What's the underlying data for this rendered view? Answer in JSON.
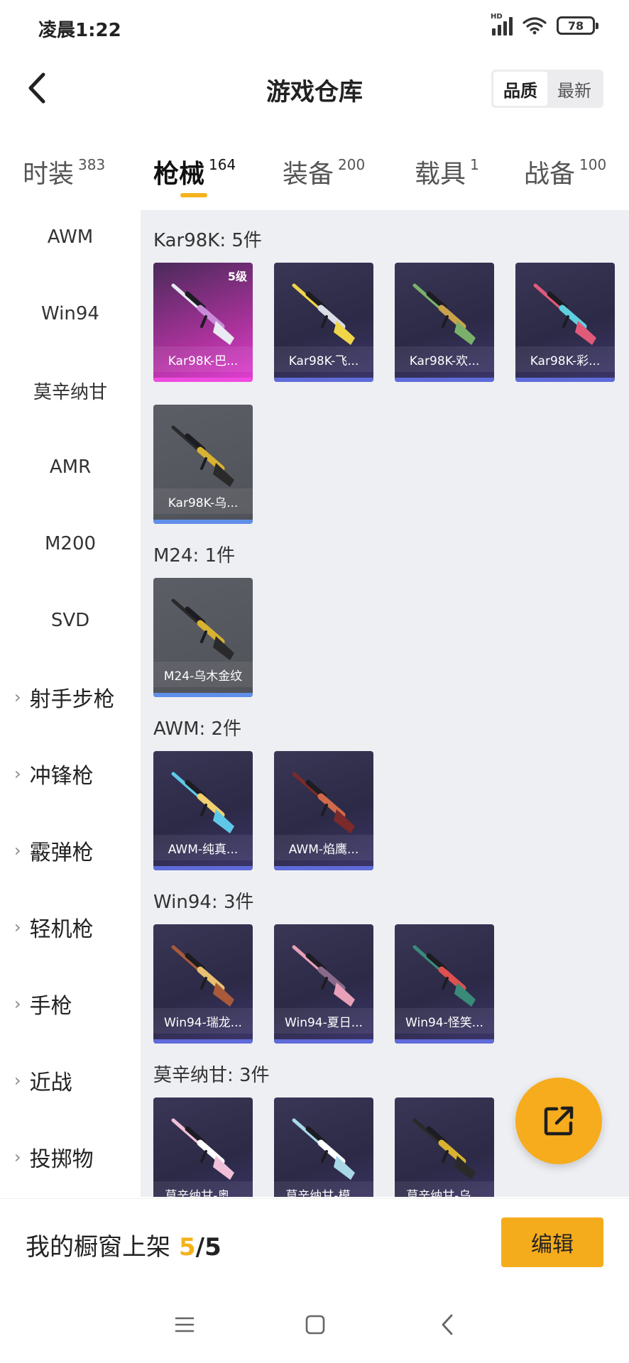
{
  "status_bar": {
    "time": "凌晨1:22",
    "battery": "78",
    "network_label": "HD"
  },
  "header": {
    "title": "游戏仓库",
    "sort_options": [
      "品质",
      "最新"
    ],
    "active_sort": "品质"
  },
  "category_tabs": [
    {
      "label": "时装",
      "count": "383"
    },
    {
      "label": "枪械",
      "count": "164",
      "active": true
    },
    {
      "label": "装备",
      "count": "200"
    },
    {
      "label": "载具",
      "count": "1"
    },
    {
      "label": "战备",
      "count": "100"
    }
  ],
  "sidebar": {
    "items": [
      "AWM",
      "Win94",
      "莫辛纳甘",
      "AMR",
      "M200",
      "SVD"
    ],
    "groups": [
      "射手步枪",
      "冲锋枪",
      "霰弹枪",
      "轻机枪",
      "手枪",
      "近战",
      "投掷物"
    ]
  },
  "sections": [
    {
      "title": "Kar98K: 5件",
      "items": [
        {
          "name": "Kar98K-巴...",
          "level": "5级",
          "quality": "pink",
          "gun_color": "#e9eaf2",
          "accent": "#c98bd8"
        },
        {
          "name": "Kar98K-飞...",
          "quality": "purple",
          "gun_color": "#f0d548",
          "accent": "#d9dde6"
        },
        {
          "name": "Kar98K-欢...",
          "quality": "purple",
          "gun_color": "#7bb06a",
          "accent": "#caa24a"
        },
        {
          "name": "Kar98K-彩...",
          "quality": "purple",
          "gun_color": "#e05a7a",
          "accent": "#5fd0e0"
        },
        {
          "name": "Kar98K-乌...",
          "quality": "gray",
          "gun_color": "#2a2a2a",
          "accent": "#d8b230"
        }
      ]
    },
    {
      "title": "M24: 1件",
      "items": [
        {
          "name": "M24-乌木金纹",
          "quality": "gray",
          "gun_color": "#2a2a2a",
          "accent": "#d8b230"
        }
      ]
    },
    {
      "title": "AWM: 2件",
      "items": [
        {
          "name": "AWM-纯真...",
          "quality": "purple",
          "gun_color": "#5fc8e8",
          "accent": "#f0d070"
        },
        {
          "name": "AWM-焰鹰...",
          "quality": "purple",
          "gun_color": "#7a2a2a",
          "accent": "#d06a4a"
        }
      ]
    },
    {
      "title": "Win94: 3件",
      "items": [
        {
          "name": "Win94-瑞龙...",
          "quality": "purple",
          "gun_color": "#a85a3a",
          "accent": "#e8c070"
        },
        {
          "name": "Win94-夏日...",
          "quality": "purple",
          "gun_color": "#e8a0b8",
          "accent": "#8a6a8a"
        },
        {
          "name": "Win94-怪笑...",
          "quality": "purple",
          "gun_color": "#3a8a7a",
          "accent": "#e05050"
        }
      ]
    },
    {
      "title": "莫辛纳甘: 3件",
      "items": [
        {
          "name": "莫辛纳甘-奥...",
          "quality": "purple",
          "gun_color": "#f0c0d8",
          "accent": "#ffffff"
        },
        {
          "name": "莫辛纳甘-模...",
          "quality": "purple",
          "gun_color": "#a8d8e8",
          "accent": "#ffffff"
        },
        {
          "name": "莫辛纳甘-乌...",
          "quality": "purple",
          "gun_color": "#2a2a2a",
          "accent": "#d8b230"
        }
      ]
    }
  ],
  "bottom_bar": {
    "label": "我的橱窗上架",
    "current": "5",
    "total": "/5",
    "edit_label": "编辑"
  },
  "colors": {
    "accent": "#f5ac1c",
    "content_bg": "#eeeff3"
  }
}
